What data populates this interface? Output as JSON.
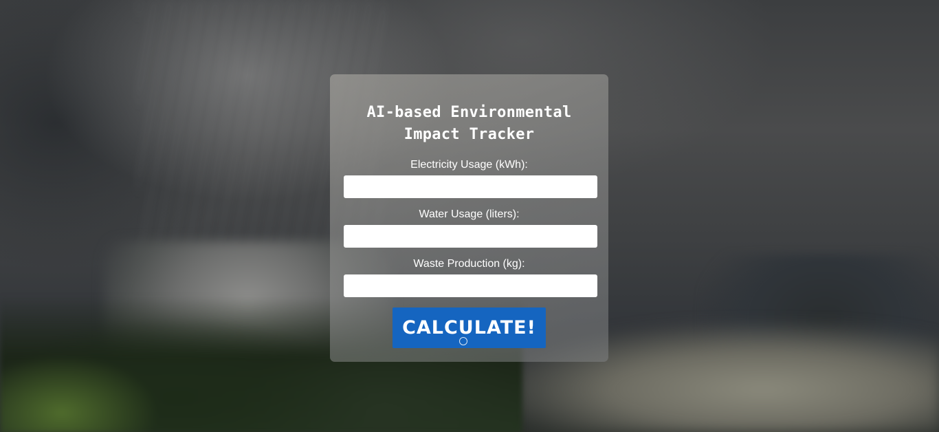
{
  "form": {
    "title": "AI-based Environmental Impact Tracker",
    "fields": [
      {
        "label": "Electricity Usage (kWh):",
        "value": "",
        "placeholder": ""
      },
      {
        "label": "Water Usage (liters):",
        "value": "",
        "placeholder": ""
      },
      {
        "label": "Waste Production (kg):",
        "value": "",
        "placeholder": ""
      }
    ],
    "submit_label": "CALCULATE!"
  },
  "colors": {
    "button": "#1565c0",
    "text": "#ffffff"
  }
}
